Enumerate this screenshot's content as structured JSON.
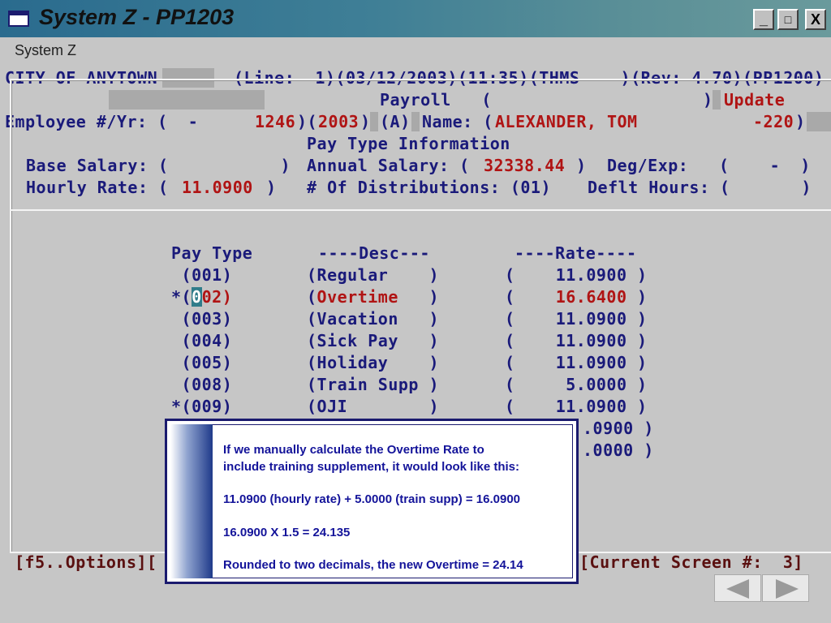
{
  "window": {
    "title": "System Z - PP1203",
    "buttons": [
      "_",
      "□",
      "X"
    ],
    "colors": {
      "title_bar": "#3f7f96",
      "text_blue": "#1a1a7a",
      "text_red": "#b01414"
    }
  },
  "menu": {
    "system_z": "System Z"
  },
  "header": {
    "city": "CITY OF ANYTOWN",
    "line_info": "(Line:  1)(03/12/2003)(11:35)(THMS    )(Rev: 4.70)(PP1200)",
    "payroll_open": "Payroll   (",
    "payroll_close": ")",
    "mode": "Update",
    "employee_label": "Employee #/Yr: (  -      ",
    "employee_num": "1246",
    "year_open": ")(",
    "year": "2003",
    "year_close": ")",
    "status": "(A)",
    "name_label": "Name: (",
    "name": "ALEXANDER, TOM",
    "dept": "-220",
    "dept_close": ")"
  },
  "section_title": "Pay Type Information",
  "fields": {
    "base_salary_label": "Base Salary: (           )",
    "annual_salary_label": "Annual Salary: (",
    "annual_salary": "32338.44",
    "annual_salary_close": ")",
    "deg_exp": "Deg/Exp:   (    -  )",
    "hourly_rate_label": "Hourly Rate: (",
    "hourly_rate": "11.0900",
    "hourly_rate_close": ")",
    "distributions": "# Of Distributions: (01)",
    "deflt_hours": "Deflt Hours: (       )"
  },
  "table": {
    "headers": {
      "pay_type": "Pay Type",
      "desc": "----Desc---",
      "rate": "----Rate----"
    },
    "rows": [
      {
        "type": " (001)",
        "desc": "(Regular    )",
        "rate": "(    11.0900 )"
      },
      {
        "type": "*(",
        "type_cursor": "0",
        "type_rest": "02)",
        "desc_open": "(",
        "desc": "Overtime",
        "desc_close": "   )",
        "rate_open": "(    ",
        "rate": "16.6400",
        "rate_close": " )"
      },
      {
        "type": " (003)",
        "desc": "(Vacation   )",
        "rate": "(    11.0900 )"
      },
      {
        "type": " (004)",
        "desc": "(Sick Pay   )",
        "rate": "(    11.0900 )"
      },
      {
        "type": " (005)",
        "desc": "(Holiday    )",
        "rate": "(    11.0900 )"
      },
      {
        "type": " (008)",
        "desc": "(Train Supp )",
        "rate": "(     5.0000 )"
      },
      {
        "type": "*(009)",
        "desc": "(OJI        )",
        "rate": "(    11.0900 )"
      },
      {
        "rate": ".0900 )"
      },
      {
        "rate": ".0000 )"
      }
    ]
  },
  "footer": {
    "left": "[f5..Options][",
    "right": "[Current Screen #:  3]"
  },
  "popup": {
    "line1": "If we manually calculate the Overtime Rate to",
    "line2": "include training supplement, it would look like this:",
    "line3": "11.0900 (hourly rate) + 5.0000 (train supp) = 16.0900",
    "line4": "16.0900 X 1.5 = 24.135",
    "line5": "Rounded to two decimals, the new Overtime = 24.14"
  },
  "nav": {
    "prev": "previous-slide",
    "next": "next-slide"
  }
}
